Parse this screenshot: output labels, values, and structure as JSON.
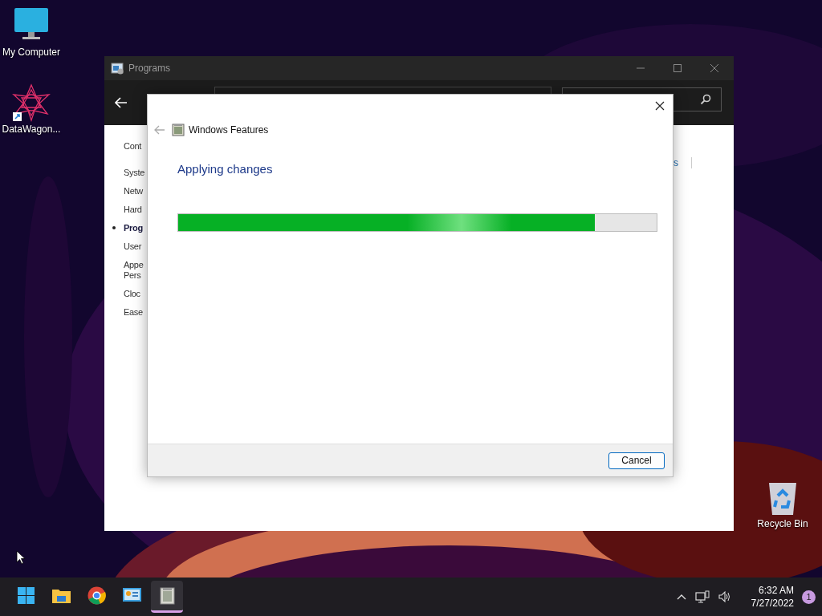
{
  "desktop_icons": [
    {
      "kind": "computer",
      "label": "My Computer"
    },
    {
      "kind": "app",
      "label": "DataWagon..."
    },
    {
      "kind": "bin",
      "label": "Recycle Bin"
    }
  ],
  "programs_window": {
    "title": "Programs",
    "sidebar": [
      {
        "label": "Cont",
        "selected": false
      },
      {
        "label": "Syste",
        "selected": false
      },
      {
        "label": "Netw",
        "selected": false
      },
      {
        "label": "Hard",
        "selected": false
      },
      {
        "label": "Prog",
        "selected": true
      },
      {
        "label": "User",
        "selected": false
      },
      {
        "label": "Appe",
        "selected": false
      },
      {
        "label": "Pers",
        "selected": false
      },
      {
        "label": "Cloc",
        "selected": false
      },
      {
        "label": "Ease",
        "selected": false
      }
    ],
    "right_fragment": "s"
  },
  "dialog": {
    "title": "Windows Features",
    "heading": "Applying changes",
    "progress": {
      "level": 0.87
    },
    "buttons": [
      "Cancel"
    ]
  },
  "taskbar": {
    "apps": [
      {
        "kind": "start",
        "active": false
      },
      {
        "kind": "folder",
        "active": false
      },
      {
        "kind": "chrome",
        "active": false
      },
      {
        "kind": "control",
        "active": false
      },
      {
        "kind": "features",
        "active": true
      }
    ],
    "time": "6:32 AM",
    "date": "7/27/2022",
    "notifications": "1"
  }
}
